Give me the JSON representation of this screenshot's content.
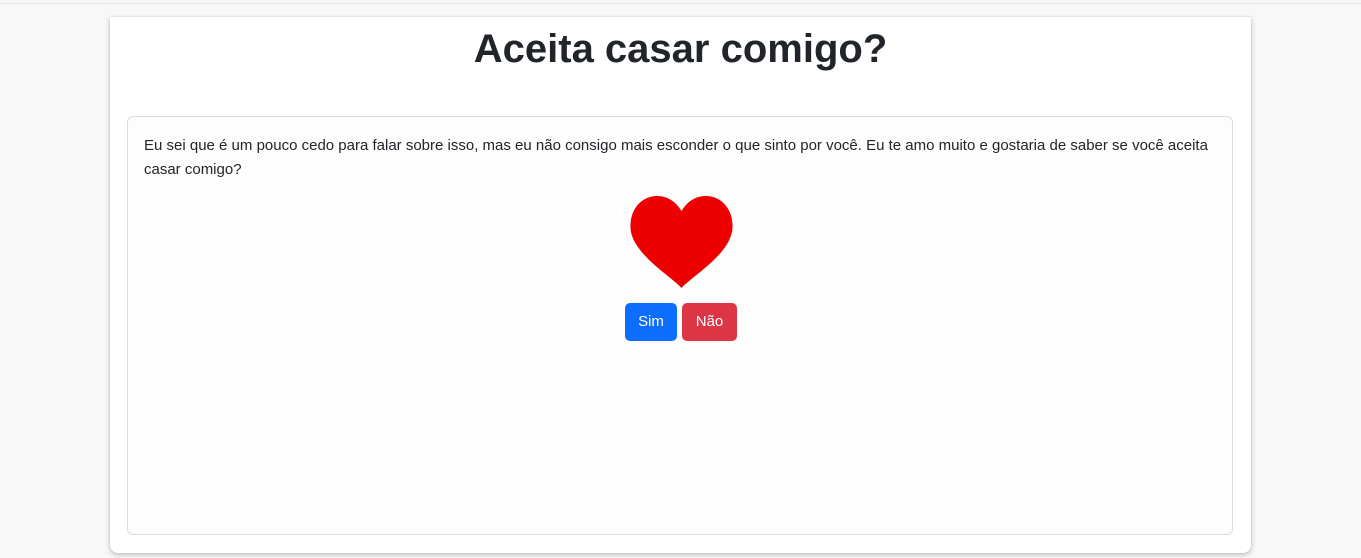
{
  "page": {
    "title": "Aceita casar comigo?"
  },
  "card": {
    "message": "Eu sei que é um pouco cedo para falar sobre isso, mas eu não consigo mais esconder o que sinto por você. Eu te amo muito e gostaria de saber se você aceita casar comigo?",
    "icon": "heart-icon"
  },
  "buttons": {
    "yes_label": "Sim",
    "no_label": "Não"
  },
  "colors": {
    "heart": "#ee0000",
    "yes": "#0d6efd",
    "no": "#dc3545"
  }
}
